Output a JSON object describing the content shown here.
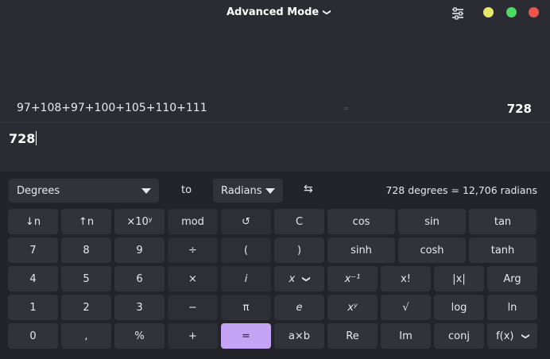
{
  "window": {
    "title": "Advanced Mode",
    "menu_icon": "sliders-icon",
    "controls": [
      {
        "name": "minimize",
        "color": "#e8e86a"
      },
      {
        "name": "maximize",
        "color": "#4cd964"
      },
      {
        "name": "close",
        "color": "#ef5350"
      }
    ]
  },
  "history": {
    "expression": "97+108+97+100+105+110+111",
    "equals": "=",
    "result": "728"
  },
  "input": {
    "value": "728"
  },
  "converter": {
    "from_unit": "Degrees",
    "to_label": "to",
    "to_unit": "Radians",
    "swap_icon": "⇆",
    "result": "728 degrees = 12,706 radians"
  },
  "keypad": {
    "row1": [
      "↓n",
      "↑n",
      "×10ʸ",
      "mod",
      "↺",
      "C",
      "cos",
      "sin",
      "tan"
    ],
    "row2": [
      "7",
      "8",
      "9",
      "÷",
      "(",
      ")",
      "sinh",
      "cosh",
      "tanh"
    ],
    "row3": [
      "4",
      "5",
      "6",
      "×",
      "i",
      "x",
      "x⁻¹",
      "x!",
      "|x|",
      "Arg"
    ],
    "row4": [
      "1",
      "2",
      "3",
      "−",
      "π",
      "e",
      "xʸ",
      "√",
      "log",
      "ln"
    ],
    "row5": [
      "0",
      ",",
      "%",
      "+",
      "=",
      "a×b",
      "Re",
      "Im",
      "conj",
      "f(x)"
    ]
  },
  "colors": {
    "accent": "#c5a3f5",
    "background": "#23232a",
    "panel": "#2b2b33",
    "button": "#32323b"
  }
}
